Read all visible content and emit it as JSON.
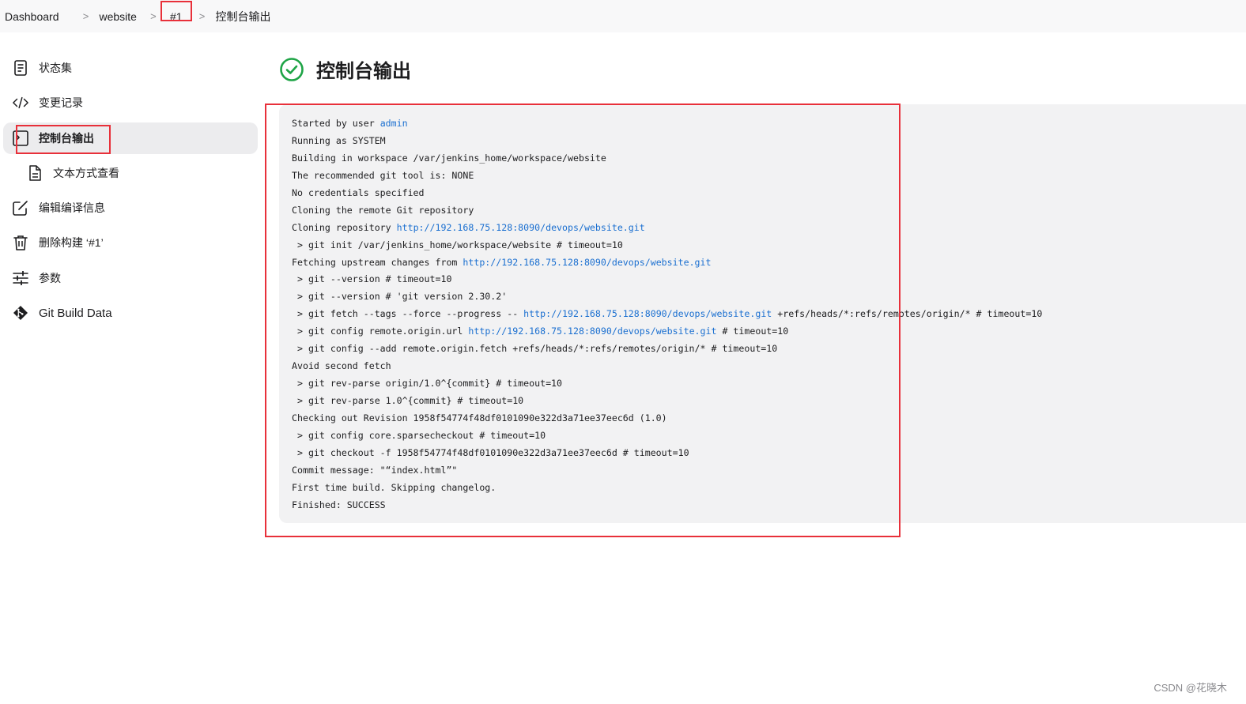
{
  "breadcrumb": {
    "items": [
      "Dashboard",
      "website",
      "#1",
      "控制台输出"
    ],
    "separator": ">"
  },
  "sidebar": {
    "items": [
      {
        "label": "状态集",
        "icon": "document-icon"
      },
      {
        "label": "变更记录",
        "icon": "code-icon"
      },
      {
        "label": "控制台输出",
        "icon": "terminal-icon",
        "active": true
      },
      {
        "label": "文本方式查看",
        "icon": "file-text-icon",
        "sub": true
      },
      {
        "label": "编辑编译信息",
        "icon": "edit-icon"
      },
      {
        "label": "删除构建 ‘#1’",
        "icon": "trash-icon"
      },
      {
        "label": "参数",
        "icon": "sliders-icon"
      },
      {
        "label": "Git Build Data",
        "icon": "git-icon"
      }
    ]
  },
  "page": {
    "title": "控制台输出",
    "status": "success",
    "status_icon": "check-circle-icon",
    "status_color": "#1ea446"
  },
  "console": {
    "lines": [
      [
        {
          "t": "Started by user "
        },
        {
          "t": "admin",
          "link": true
        }
      ],
      [
        {
          "t": "Running as SYSTEM"
        }
      ],
      [
        {
          "t": "Building in workspace /var/jenkins_home/workspace/website"
        }
      ],
      [
        {
          "t": "The recommended git tool is: NONE"
        }
      ],
      [
        {
          "t": "No credentials specified"
        }
      ],
      [
        {
          "t": "Cloning the remote Git repository"
        }
      ],
      [
        {
          "t": "Cloning repository "
        },
        {
          "t": "http://192.168.75.128:8090/devops/website.git",
          "link": true
        }
      ],
      [
        {
          "t": " > git init /var/jenkins_home/workspace/website # timeout=10"
        }
      ],
      [
        {
          "t": "Fetching upstream changes from "
        },
        {
          "t": "http://192.168.75.128:8090/devops/website.git",
          "link": true
        }
      ],
      [
        {
          "t": " > git --version # timeout=10"
        }
      ],
      [
        {
          "t": " > git --version # 'git version 2.30.2'"
        }
      ],
      [
        {
          "t": " > git fetch --tags --force --progress -- "
        },
        {
          "t": "http://192.168.75.128:8090/devops/website.git",
          "link": true
        },
        {
          "t": " +refs/heads/*:refs/remotes/origin/* # timeout=10"
        }
      ],
      [
        {
          "t": " > git config remote.origin.url "
        },
        {
          "t": "http://192.168.75.128:8090/devops/website.git",
          "link": true
        },
        {
          "t": " # timeout=10"
        }
      ],
      [
        {
          "t": " > git config --add remote.origin.fetch +refs/heads/*:refs/remotes/origin/* # timeout=10"
        }
      ],
      [
        {
          "t": "Avoid second fetch"
        }
      ],
      [
        {
          "t": " > git rev-parse origin/1.0^{commit} # timeout=10"
        }
      ],
      [
        {
          "t": " > git rev-parse 1.0^{commit} # timeout=10"
        }
      ],
      [
        {
          "t": "Checking out Revision 1958f54774f48df0101090e322d3a71ee37eec6d (1.0)"
        }
      ],
      [
        {
          "t": " > git config core.sparsecheckout # timeout=10"
        }
      ],
      [
        {
          "t": " > git checkout -f 1958f54774f48df0101090e322d3a71ee37eec6d # timeout=10"
        }
      ],
      [
        {
          "t": "Commit message: \"“index.html”\""
        }
      ],
      [
        {
          "t": "First time build. Skipping changelog."
        }
      ],
      [
        {
          "t": "Finished: SUCCESS"
        }
      ]
    ]
  },
  "annotations": {
    "highlight_color": "#e8303a"
  },
  "watermark": "CSDN @花晓木"
}
